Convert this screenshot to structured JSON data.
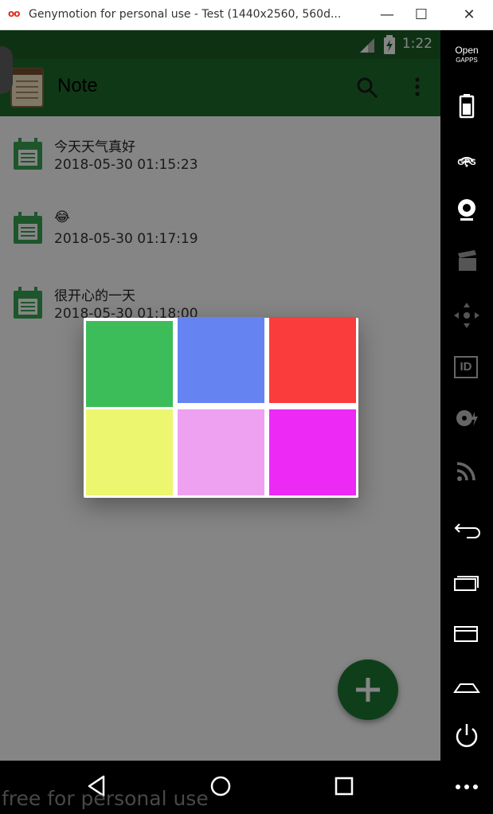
{
  "window": {
    "logo": "oo",
    "title": "Genymotion for personal use - Test (1440x2560, 560d...",
    "minimize_glyph": "—",
    "maximize_glyph": "☐",
    "close_glyph": "✕"
  },
  "statusbar": {
    "time": "1:22"
  },
  "app": {
    "title": "Note"
  },
  "notes": [
    {
      "title": "今天天气真好",
      "date": "2018-05-30 01:15:23"
    },
    {
      "title": "😂",
      "date": "2018-05-30 01:17:19"
    },
    {
      "title": "很开心的一天",
      "date": "2018-05-30 01:18:00"
    }
  ],
  "color_dialog": {
    "colors": [
      "#3dbd5a",
      "#6683f2",
      "#fb3c3c",
      "#edf66f",
      "#eea1f0",
      "#ec29f5"
    ]
  },
  "sidebar": {
    "gapps_label_1": "Open",
    "gapps_label_2": "GAPPS",
    "gps_label": "GPS",
    "id_label": "ID"
  },
  "watermark": "free for personal use",
  "colors": {
    "statusbar": "#1b5e28",
    "appbar": "#1d6b2c",
    "fab": "#1d7a33",
    "note_icon": "#3aa655"
  }
}
